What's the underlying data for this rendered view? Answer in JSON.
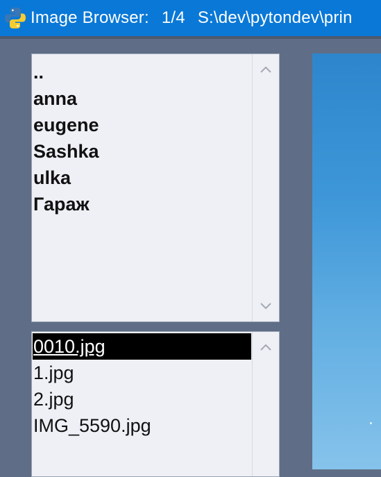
{
  "window": {
    "title_app": "Image Browser:",
    "title_position": "1/4",
    "title_path": "S:\\dev\\pytondev\\prin",
    "titlebar_color": "#0a78d7",
    "background_color": "#5f6e86",
    "icon": "python-icon"
  },
  "directory_list": {
    "items": [
      "..",
      "anna",
      "eugene",
      "Sashka",
      "ulka",
      "Гараж"
    ]
  },
  "file_list": {
    "items": [
      "0010.jpg",
      "1.jpg",
      "2.jpg",
      "IMG_5590.jpg"
    ],
    "selected_item": "0010.jpg"
  },
  "scrollbar_icons": {
    "up": "chevron-up-icon",
    "down": "chevron-down-icon"
  }
}
